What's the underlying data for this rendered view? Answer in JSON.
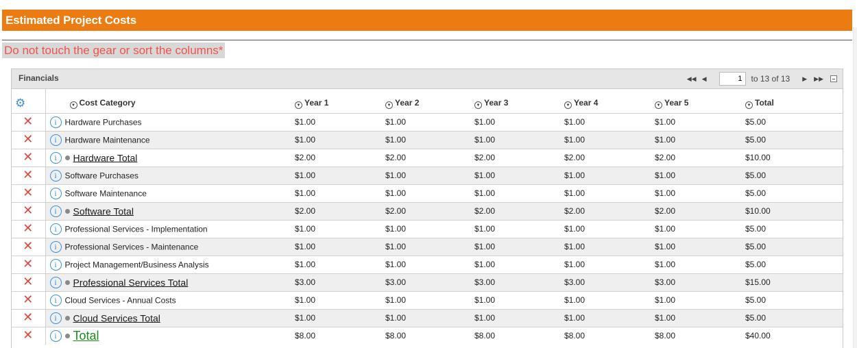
{
  "page": {
    "title": "Estimated Project Costs",
    "warning": "Do not touch the gear or sort the columns*"
  },
  "panel": {
    "title": "Financials",
    "pager": {
      "page_value": "1",
      "range_text": "to 13 of 13"
    }
  },
  "columns": [
    "Cost Category",
    "Year 1",
    "Year 2",
    "Year 3",
    "Year 4",
    "Year 5",
    "Total"
  ],
  "rows": [
    {
      "category": "Hardware Purchases",
      "type": "item",
      "values": [
        "$1.00",
        "$1.00",
        "$1.00",
        "$1.00",
        "$1.00",
        "$5.00"
      ]
    },
    {
      "category": "Hardware Maintenance",
      "type": "item",
      "values": [
        "$1.00",
        "$1.00",
        "$1.00",
        "$1.00",
        "$1.00",
        "$5.00"
      ]
    },
    {
      "category": "Hardware Total",
      "type": "subtotal",
      "values": [
        "$2.00",
        "$2.00",
        "$2.00",
        "$2.00",
        "$2.00",
        "$10.00"
      ]
    },
    {
      "category": "Software Purchases",
      "type": "item",
      "values": [
        "$1.00",
        "$1.00",
        "$1.00",
        "$1.00",
        "$1.00",
        "$5.00"
      ]
    },
    {
      "category": "Software Maintenance",
      "type": "item",
      "values": [
        "$1.00",
        "$1.00",
        "$1.00",
        "$1.00",
        "$1.00",
        "$5.00"
      ]
    },
    {
      "category": "Software Total",
      "type": "subtotal",
      "values": [
        "$2.00",
        "$2.00",
        "$2.00",
        "$2.00",
        "$2.00",
        "$10.00"
      ]
    },
    {
      "category": "Professional Services - Implementation",
      "type": "item",
      "values": [
        "$1.00",
        "$1.00",
        "$1.00",
        "$1.00",
        "$1.00",
        "$5.00"
      ]
    },
    {
      "category": "Professional Services - Maintenance",
      "type": "item",
      "values": [
        "$1.00",
        "$1.00",
        "$1.00",
        "$1.00",
        "$1.00",
        "$5.00"
      ]
    },
    {
      "category": "Project Management/Business Analysis",
      "type": "item",
      "values": [
        "$1.00",
        "$1.00",
        "$1.00",
        "$1.00",
        "$1.00",
        "$5.00"
      ]
    },
    {
      "category": "Professional Services Total",
      "type": "subtotal",
      "values": [
        "$3.00",
        "$3.00",
        "$3.00",
        "$3.00",
        "$3.00",
        "$15.00"
      ]
    },
    {
      "category": "Cloud Services - Annual Costs",
      "type": "item",
      "values": [
        "$1.00",
        "$1.00",
        "$1.00",
        "$1.00",
        "$1.00",
        "$5.00"
      ]
    },
    {
      "category": "Cloud Services Total",
      "type": "subtotal",
      "values": [
        "$1.00",
        "$1.00",
        "$1.00",
        "$1.00",
        "$1.00",
        "$5.00"
      ]
    },
    {
      "category": "Total",
      "type": "grand",
      "values": [
        "$8.00",
        "$8.00",
        "$8.00",
        "$8.00",
        "$8.00",
        "$40.00"
      ]
    }
  ],
  "icons": {
    "delete": "close-x-icon",
    "info": "info-icon",
    "settings": "gear-icon",
    "sort": "sort-circle-icon"
  },
  "colors": {
    "header_bg": "#ec7c12",
    "warning_text": "#f0524a",
    "delete_icon": "#e0443a",
    "info_icon": "#3a8fd8",
    "grand_total_link": "#1a8a22"
  }
}
